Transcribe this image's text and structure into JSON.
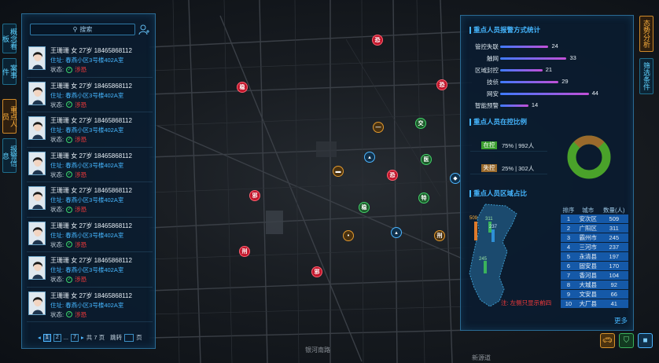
{
  "left_nav": [
    "概念看板",
    "案事件",
    "重点人员",
    "报警信息"
  ],
  "right_nav": [
    "态势分析",
    "筛选条件"
  ],
  "search": {
    "placeholder": "搜索"
  },
  "person": {
    "line1": "王珊珊  女  27岁  18465868112",
    "line2": "住址:  春燕小区3号楼402A室",
    "status_label": "状态:",
    "tag": "涉恐"
  },
  "persons_count": 8,
  "pager": {
    "pages": [
      "1",
      "2",
      "...",
      "7"
    ],
    "total": "共 7 页",
    "jump": "跳转",
    "unit": "页"
  },
  "stats": {
    "title1": "重点人员报警方式统计",
    "bars": [
      {
        "label": "管控失联",
        "value": 24
      },
      {
        "label": "触网",
        "value": 33
      },
      {
        "label": "区域封控",
        "value": 21
      },
      {
        "label": "技侦",
        "value": 29
      },
      {
        "label": "网安",
        "value": 44
      },
      {
        "label": "智能预警",
        "value": 14
      }
    ],
    "title2": "重点人员在控比例",
    "control": [
      {
        "tag": "在控",
        "info": "75%  |  992人",
        "color": "#3ba02f"
      },
      {
        "tag": "失控",
        "info": "25%  |  302人",
        "color": "#9a6a2c"
      }
    ],
    "title3": "重点人员区域占比",
    "map_values": [
      "509",
      "311",
      "237",
      "245"
    ],
    "map_note": "注: 左侧只显示前四",
    "table_headers": [
      "排序",
      "城市",
      "数量(人)"
    ],
    "table_rows": [
      [
        "1",
        "安次区",
        "509"
      ],
      [
        "2",
        "广阳区",
        "311"
      ],
      [
        "3",
        "霸州市",
        "245"
      ],
      [
        "4",
        "三河市",
        "237"
      ],
      [
        "5",
        "永清县",
        "197"
      ],
      [
        "6",
        "固安县",
        "170"
      ],
      [
        "7",
        "香河县",
        "104"
      ],
      [
        "8",
        "大城县",
        "92"
      ],
      [
        "9",
        "文安县",
        "66"
      ],
      [
        "10",
        "大厂县",
        "41"
      ]
    ],
    "more": "更多"
  },
  "map_road_labels": [
    "银河南路",
    "新源道"
  ],
  "markers": [
    "恐",
    "稳",
    "恐",
    "交",
    "医",
    "特",
    "稳",
    "特",
    "邪",
    "刑",
    "邪",
    "消",
    "网"
  ],
  "colors": {
    "accent": "#45b6ff",
    "alert": "#ff3b3b",
    "orange": "#ffb23e",
    "panel_border": "#2a6a93"
  }
}
